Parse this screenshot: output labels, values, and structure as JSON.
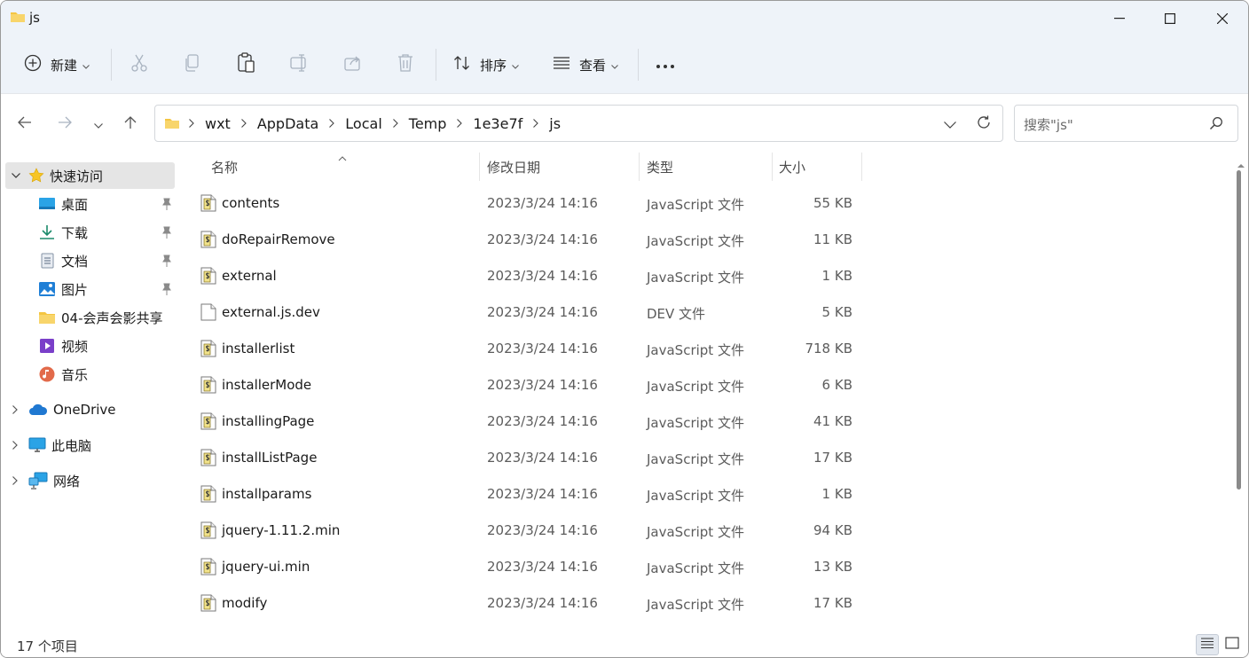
{
  "window": {
    "title": "js"
  },
  "toolbar": {
    "new_label": "新建",
    "sort_label": "排序",
    "view_label": "查看"
  },
  "address": {
    "crumbs": [
      "wxt",
      "AppData",
      "Local",
      "Temp",
      "1e3e7f",
      "js"
    ]
  },
  "search": {
    "placeholder": "搜索\"js\""
  },
  "sidebar": {
    "quick_access": "快速访问",
    "items": [
      {
        "label": "桌面",
        "icon": "desktop-icon"
      },
      {
        "label": "下载",
        "icon": "download-icon"
      },
      {
        "label": "文档",
        "icon": "document-icon"
      },
      {
        "label": "图片",
        "icon": "pictures-icon"
      },
      {
        "label": "04-会声会影共享",
        "icon": "folder-icon"
      },
      {
        "label": "视频",
        "icon": "video-icon"
      },
      {
        "label": "音乐",
        "icon": "music-icon"
      }
    ],
    "onedrive": "OneDrive",
    "thispc": "此电脑",
    "network": "网络"
  },
  "columns": {
    "name": "名称",
    "date": "修改日期",
    "type": "类型",
    "size": "大小"
  },
  "files": [
    {
      "name": "contents",
      "date": "2023/3/24 14:16",
      "type": "JavaScript 文件",
      "size": "55 KB",
      "kind": "js"
    },
    {
      "name": "doRepairRemove",
      "date": "2023/3/24 14:16",
      "type": "JavaScript 文件",
      "size": "11 KB",
      "kind": "js"
    },
    {
      "name": "external",
      "date": "2023/3/24 14:16",
      "type": "JavaScript 文件",
      "size": "1 KB",
      "kind": "js"
    },
    {
      "name": "external.js.dev",
      "date": "2023/3/24 14:16",
      "type": "DEV 文件",
      "size": "5 KB",
      "kind": "blank"
    },
    {
      "name": "installerlist",
      "date": "2023/3/24 14:16",
      "type": "JavaScript 文件",
      "size": "718 KB",
      "kind": "js"
    },
    {
      "name": "installerMode",
      "date": "2023/3/24 14:16",
      "type": "JavaScript 文件",
      "size": "6 KB",
      "kind": "js"
    },
    {
      "name": "installingPage",
      "date": "2023/3/24 14:16",
      "type": "JavaScript 文件",
      "size": "41 KB",
      "kind": "js"
    },
    {
      "name": "installListPage",
      "date": "2023/3/24 14:16",
      "type": "JavaScript 文件",
      "size": "17 KB",
      "kind": "js"
    },
    {
      "name": "installparams",
      "date": "2023/3/24 14:16",
      "type": "JavaScript 文件",
      "size": "1 KB",
      "kind": "js"
    },
    {
      "name": "jquery-1.11.2.min",
      "date": "2023/3/24 14:16",
      "type": "JavaScript 文件",
      "size": "94 KB",
      "kind": "js"
    },
    {
      "name": "jquery-ui.min",
      "date": "2023/3/24 14:16",
      "type": "JavaScript 文件",
      "size": "13 KB",
      "kind": "js"
    },
    {
      "name": "modify",
      "date": "2023/3/24 14:16",
      "type": "JavaScript 文件",
      "size": "17 KB",
      "kind": "js"
    }
  ],
  "status": {
    "count": "17 个项目"
  },
  "colors": {
    "chrome_bg": "#eef3f9",
    "selected_bg": "#e5e5e5",
    "folder_yellow": "#f4c542"
  }
}
